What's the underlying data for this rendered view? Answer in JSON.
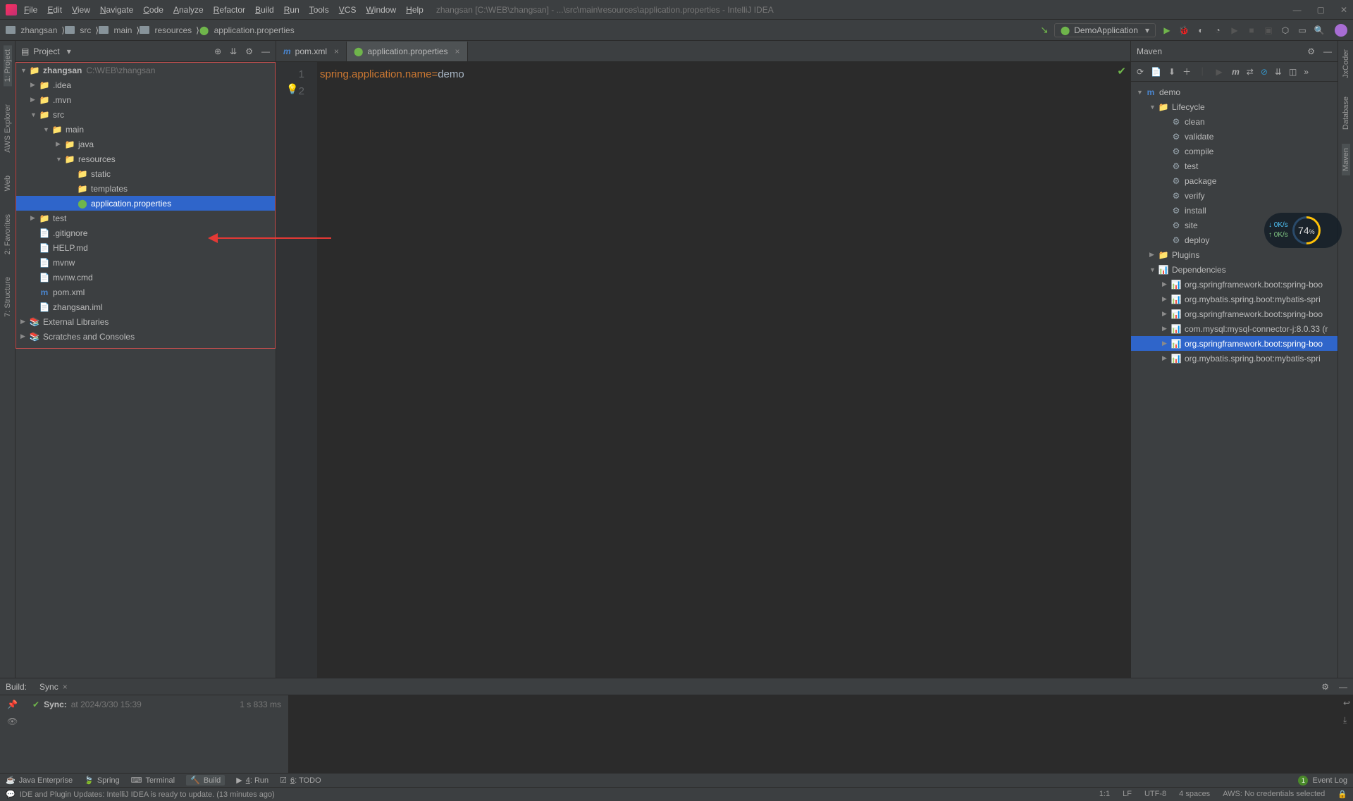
{
  "menu": [
    "File",
    "Edit",
    "View",
    "Navigate",
    "Code",
    "Analyze",
    "Refactor",
    "Build",
    "Run",
    "Tools",
    "VCS",
    "Window",
    "Help"
  ],
  "title_path": "zhangsan [C:\\WEB\\zhangsan] - ...\\src\\main\\resources\\application.properties - IntelliJ IDEA",
  "breadcrumb": [
    "zhangsan",
    "src",
    "main",
    "resources",
    "application.properties"
  ],
  "run_config": "DemoApplication",
  "project_panel": {
    "title": "Project",
    "root": {
      "name": "zhangsan",
      "path": "C:\\WEB\\zhangsan"
    },
    "nodes": [
      {
        "lvl": 1,
        "name": ".idea",
        "type": "folder",
        "ar": "▶"
      },
      {
        "lvl": 1,
        "name": ".mvn",
        "type": "folder",
        "ar": "▶"
      },
      {
        "lvl": 1,
        "name": "src",
        "type": "folder",
        "ar": "▼"
      },
      {
        "lvl": 2,
        "name": "main",
        "type": "folder",
        "ar": "▼"
      },
      {
        "lvl": 3,
        "name": "java",
        "type": "pkg",
        "ar": "▶"
      },
      {
        "lvl": 3,
        "name": "resources",
        "type": "res",
        "ar": "▼"
      },
      {
        "lvl": 4,
        "name": "static",
        "type": "folder",
        "ar": ""
      },
      {
        "lvl": 4,
        "name": "templates",
        "type": "folder",
        "ar": ""
      },
      {
        "lvl": 4,
        "name": "application.properties",
        "type": "prop",
        "ar": "",
        "selected": true
      },
      {
        "lvl": 1,
        "name": "test",
        "type": "folder",
        "ar": "▶"
      },
      {
        "lvl": 1,
        "name": ".gitignore",
        "type": "file",
        "ar": ""
      },
      {
        "lvl": 1,
        "name": "HELP.md",
        "type": "md",
        "ar": ""
      },
      {
        "lvl": 1,
        "name": "mvnw",
        "type": "file",
        "ar": ""
      },
      {
        "lvl": 1,
        "name": "mvnw.cmd",
        "type": "file",
        "ar": ""
      },
      {
        "lvl": 1,
        "name": "pom.xml",
        "type": "maven",
        "ar": ""
      },
      {
        "lvl": 1,
        "name": "zhangsan.iml",
        "type": "file",
        "ar": ""
      }
    ],
    "extra": [
      "External Libraries",
      "Scratches and Consoles"
    ]
  },
  "tabs": [
    {
      "name": "pom.xml",
      "icon": "m",
      "active": false
    },
    {
      "name": "application.properties",
      "icon": "leaf",
      "active": true
    }
  ],
  "code": {
    "lines": [
      "1",
      "2"
    ],
    "key": "spring.application.name",
    "eq": "=",
    "val": "demo"
  },
  "maven": {
    "title": "Maven",
    "root": "demo",
    "lifecycle_label": "Lifecycle",
    "lifecycle": [
      "clean",
      "validate",
      "compile",
      "test",
      "package",
      "verify",
      "install",
      "site",
      "deploy"
    ],
    "plugins_label": "Plugins",
    "deps_label": "Dependencies",
    "deps": [
      "org.springframework.boot:spring-boo",
      "org.mybatis.spring.boot:mybatis-spri",
      "org.springframework.boot:spring-boo",
      "com.mysql:mysql-connector-j:8.0.33 (r",
      "org.springframework.boot:spring-boo",
      "org.mybatis.spring.boot:mybatis-spri"
    ],
    "selected_dep": 4
  },
  "left_strip": [
    "1: Project",
    "AWS Explorer",
    "Web",
    "2: Favorites",
    "7: Structure"
  ],
  "right_strip": [
    "JxCoder",
    "Database",
    "Maven"
  ],
  "build": {
    "head_label": "Build:",
    "tab": "Sync",
    "sync_label": "Sync:",
    "sync_time": "at 2024/3/30 15:39",
    "duration": "1 s 833 ms"
  },
  "bottom_tabs": [
    "Java Enterprise",
    "Spring",
    "Terminal",
    "Build",
    "4: Run",
    "6: TODO"
  ],
  "bottom_active": "Build",
  "event_log": {
    "count": "1",
    "label": "Event Log"
  },
  "status": {
    "msg": "IDE and Plugin Updates: IntelliJ IDEA is ready to update. (13 minutes ago)",
    "pos": "1:1",
    "le": "LF",
    "enc": "UTF-8",
    "indent": "4 spaces",
    "aws": "AWS: No credentials selected"
  },
  "net": {
    "down": "0K/s",
    "up": "0K/s",
    "pct": "74",
    "unit": "%"
  }
}
